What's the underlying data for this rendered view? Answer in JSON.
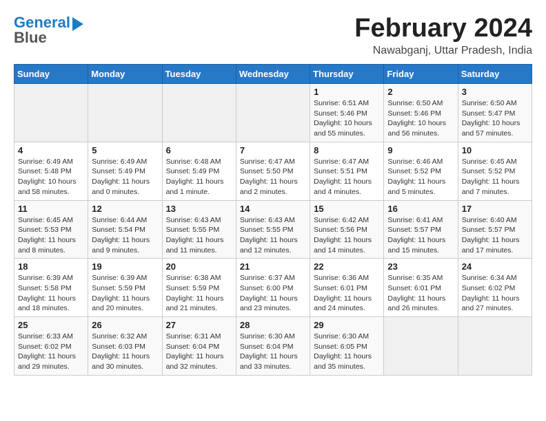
{
  "header": {
    "logo_line1": "General",
    "logo_line2": "Blue",
    "title": "February 2024",
    "subtitle": "Nawabganj, Uttar Pradesh, India"
  },
  "days_of_week": [
    "Sunday",
    "Monday",
    "Tuesday",
    "Wednesday",
    "Thursday",
    "Friday",
    "Saturday"
  ],
  "weeks": [
    [
      {
        "day": "",
        "info": ""
      },
      {
        "day": "",
        "info": ""
      },
      {
        "day": "",
        "info": ""
      },
      {
        "day": "",
        "info": ""
      },
      {
        "day": "1",
        "info": "Sunrise: 6:51 AM\nSunset: 5:46 PM\nDaylight: 10 hours and 55 minutes."
      },
      {
        "day": "2",
        "info": "Sunrise: 6:50 AM\nSunset: 5:46 PM\nDaylight: 10 hours and 56 minutes."
      },
      {
        "day": "3",
        "info": "Sunrise: 6:50 AM\nSunset: 5:47 PM\nDaylight: 10 hours and 57 minutes."
      }
    ],
    [
      {
        "day": "4",
        "info": "Sunrise: 6:49 AM\nSunset: 5:48 PM\nDaylight: 10 hours and 58 minutes."
      },
      {
        "day": "5",
        "info": "Sunrise: 6:49 AM\nSunset: 5:49 PM\nDaylight: 11 hours and 0 minutes."
      },
      {
        "day": "6",
        "info": "Sunrise: 6:48 AM\nSunset: 5:49 PM\nDaylight: 11 hours and 1 minute."
      },
      {
        "day": "7",
        "info": "Sunrise: 6:47 AM\nSunset: 5:50 PM\nDaylight: 11 hours and 2 minutes."
      },
      {
        "day": "8",
        "info": "Sunrise: 6:47 AM\nSunset: 5:51 PM\nDaylight: 11 hours and 4 minutes."
      },
      {
        "day": "9",
        "info": "Sunrise: 6:46 AM\nSunset: 5:52 PM\nDaylight: 11 hours and 5 minutes."
      },
      {
        "day": "10",
        "info": "Sunrise: 6:45 AM\nSunset: 5:52 PM\nDaylight: 11 hours and 7 minutes."
      }
    ],
    [
      {
        "day": "11",
        "info": "Sunrise: 6:45 AM\nSunset: 5:53 PM\nDaylight: 11 hours and 8 minutes."
      },
      {
        "day": "12",
        "info": "Sunrise: 6:44 AM\nSunset: 5:54 PM\nDaylight: 11 hours and 9 minutes."
      },
      {
        "day": "13",
        "info": "Sunrise: 6:43 AM\nSunset: 5:55 PM\nDaylight: 11 hours and 11 minutes."
      },
      {
        "day": "14",
        "info": "Sunrise: 6:43 AM\nSunset: 5:55 PM\nDaylight: 11 hours and 12 minutes."
      },
      {
        "day": "15",
        "info": "Sunrise: 6:42 AM\nSunset: 5:56 PM\nDaylight: 11 hours and 14 minutes."
      },
      {
        "day": "16",
        "info": "Sunrise: 6:41 AM\nSunset: 5:57 PM\nDaylight: 11 hours and 15 minutes."
      },
      {
        "day": "17",
        "info": "Sunrise: 6:40 AM\nSunset: 5:57 PM\nDaylight: 11 hours and 17 minutes."
      }
    ],
    [
      {
        "day": "18",
        "info": "Sunrise: 6:39 AM\nSunset: 5:58 PM\nDaylight: 11 hours and 18 minutes."
      },
      {
        "day": "19",
        "info": "Sunrise: 6:39 AM\nSunset: 5:59 PM\nDaylight: 11 hours and 20 minutes."
      },
      {
        "day": "20",
        "info": "Sunrise: 6:38 AM\nSunset: 5:59 PM\nDaylight: 11 hours and 21 minutes."
      },
      {
        "day": "21",
        "info": "Sunrise: 6:37 AM\nSunset: 6:00 PM\nDaylight: 11 hours and 23 minutes."
      },
      {
        "day": "22",
        "info": "Sunrise: 6:36 AM\nSunset: 6:01 PM\nDaylight: 11 hours and 24 minutes."
      },
      {
        "day": "23",
        "info": "Sunrise: 6:35 AM\nSunset: 6:01 PM\nDaylight: 11 hours and 26 minutes."
      },
      {
        "day": "24",
        "info": "Sunrise: 6:34 AM\nSunset: 6:02 PM\nDaylight: 11 hours and 27 minutes."
      }
    ],
    [
      {
        "day": "25",
        "info": "Sunrise: 6:33 AM\nSunset: 6:02 PM\nDaylight: 11 hours and 29 minutes."
      },
      {
        "day": "26",
        "info": "Sunrise: 6:32 AM\nSunset: 6:03 PM\nDaylight: 11 hours and 30 minutes."
      },
      {
        "day": "27",
        "info": "Sunrise: 6:31 AM\nSunset: 6:04 PM\nDaylight: 11 hours and 32 minutes."
      },
      {
        "day": "28",
        "info": "Sunrise: 6:30 AM\nSunset: 6:04 PM\nDaylight: 11 hours and 33 minutes."
      },
      {
        "day": "29",
        "info": "Sunrise: 6:30 AM\nSunset: 6:05 PM\nDaylight: 11 hours and 35 minutes."
      },
      {
        "day": "",
        "info": ""
      },
      {
        "day": "",
        "info": ""
      }
    ]
  ]
}
